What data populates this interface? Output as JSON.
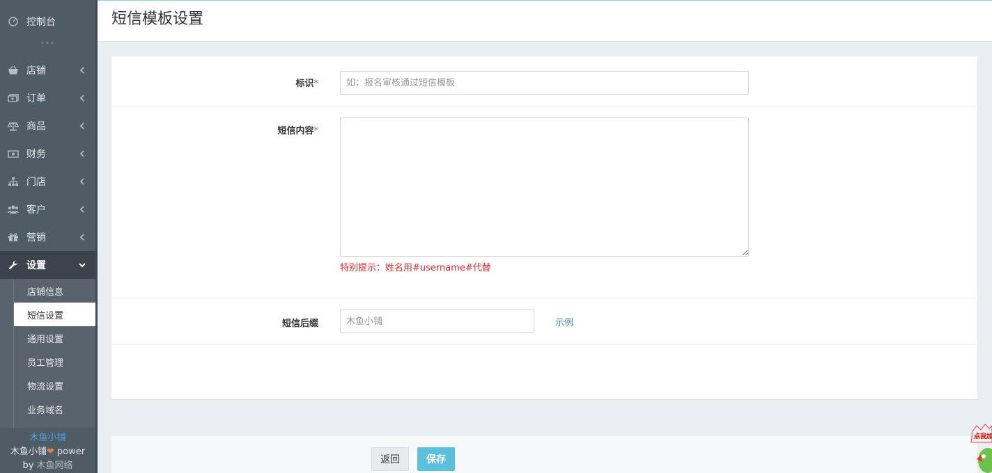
{
  "sidebar": {
    "top_item": "控制台",
    "separator": "•••",
    "items": [
      {
        "label": "店铺",
        "icon": "shop-basket-icon"
      },
      {
        "label": "订单",
        "icon": "money-icon"
      },
      {
        "label": "商品",
        "icon": "scale-icon"
      },
      {
        "label": "财务",
        "icon": "cash-icon"
      },
      {
        "label": "门店",
        "icon": "sitemap-icon"
      },
      {
        "label": "客户",
        "icon": "users-icon"
      },
      {
        "label": "营销",
        "icon": "gift-icon"
      },
      {
        "label": "设置",
        "icon": "wrench-icon",
        "active": true
      }
    ],
    "sub_items": [
      {
        "label": "店铺信息"
      },
      {
        "label": "短信设置",
        "current": true
      },
      {
        "label": "通用设置"
      },
      {
        "label": "员工管理"
      },
      {
        "label": "物流设置"
      },
      {
        "label": "业务域名"
      }
    ],
    "brand": {
      "name": "木鱼小铺",
      "power_prefix": "木鱼小铺",
      "power_suffix": " power",
      "by_prefix": "by ",
      "by_name": "木鱼网络"
    }
  },
  "header": {
    "title": "短信模板设置"
  },
  "form": {
    "identifier": {
      "label": "标识",
      "required_mark": "*",
      "placeholder": "如：报名审核通过短信模板",
      "value": ""
    },
    "content": {
      "label": "短信内容",
      "required_mark": "*",
      "value": "",
      "hint": "特别提示：姓名用#username#代替"
    },
    "suffix": {
      "label": "短信后缀",
      "placeholder": "木鱼小铺",
      "value": "",
      "example_link": "示例"
    }
  },
  "actions": {
    "back_label": "返回",
    "save_label": "保存"
  },
  "floating_widget": {
    "text": "点我加"
  },
  "colors": {
    "sidebar_bg": "#4f5b65",
    "accent": "#5bc0de",
    "required": "#d9534f",
    "hint": "#e4282b",
    "link": "#3a86c8"
  }
}
